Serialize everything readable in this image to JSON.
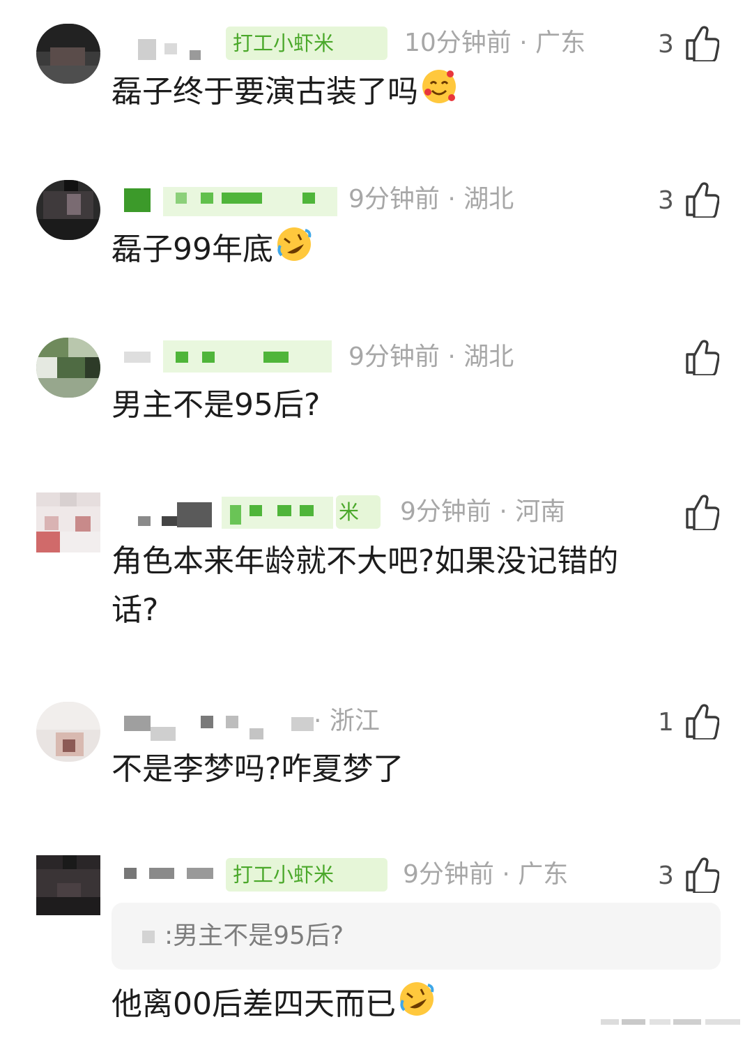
{
  "comments": [
    {
      "badge": "打工小虾米",
      "time": "10分钟前",
      "sep": " · ",
      "region": "广东",
      "likes": "3",
      "text": "磊子终于要演古装了吗",
      "emoji": "smiling-face-with-hearts"
    },
    {
      "badge": "",
      "time": "9分钟前",
      "sep": " · ",
      "region": "湖北",
      "likes": "3",
      "text": "磊子99年底",
      "emoji": "rolling-on-floor-laughing"
    },
    {
      "badge": "",
      "time": "9分钟前",
      "sep": " · ",
      "region": "湖北",
      "likes": "",
      "text": "男主不是95后?",
      "emoji": ""
    },
    {
      "badge": "米",
      "time": "9分钟前",
      "sep": " · ",
      "region": "河南",
      "likes": "",
      "text_line1": "角色本来年龄就不大吧?如果没记错的",
      "text_line2": "话?",
      "emoji": ""
    },
    {
      "badge": "",
      "time": "",
      "sep": " · ",
      "region": "浙江",
      "likes": "1",
      "text": "不是李梦吗?咋夏梦了",
      "emoji": ""
    },
    {
      "badge": "打工小虾米",
      "time": "9分钟前",
      "sep": " · ",
      "region": "广东",
      "likes": "3",
      "quote": ":男主不是95后?",
      "text": "他离00后差四天而已",
      "emoji": "rolling-on-floor-laughing"
    }
  ],
  "icons": {
    "like": "thumbs-up-icon"
  },
  "colors": {
    "badge_bg": "#e6f6d8",
    "badge_text": "#4aa82a",
    "meta_text": "#a7a7a7",
    "body_text": "#1c1c1c"
  }
}
